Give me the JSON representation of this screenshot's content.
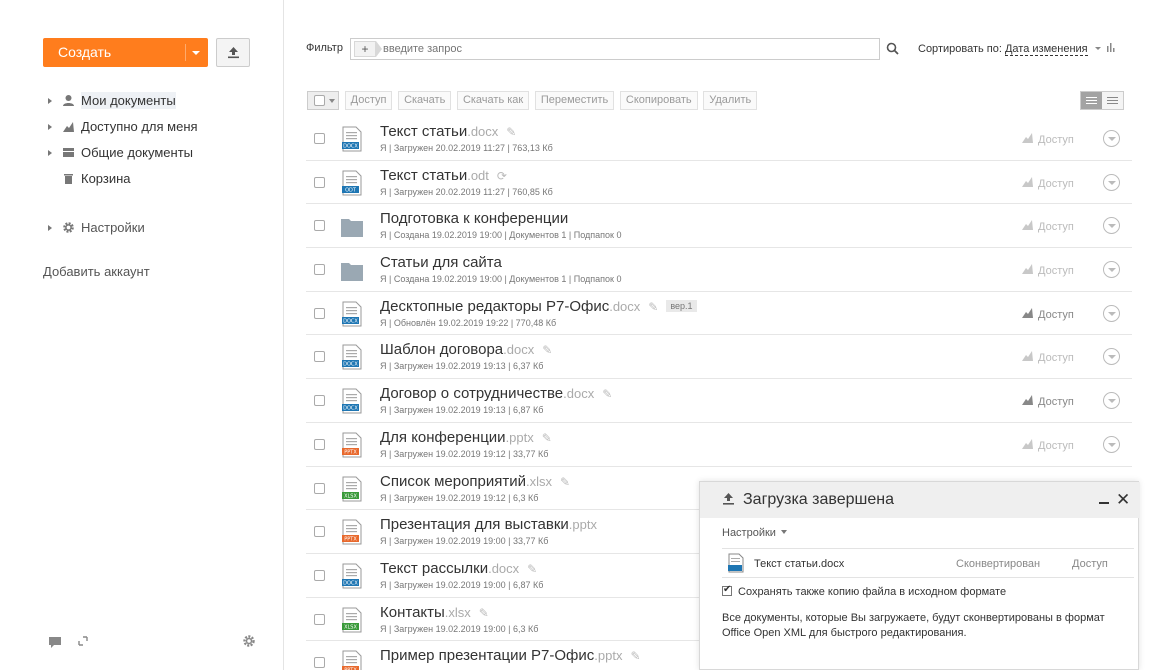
{
  "sidebar": {
    "create_label": "Создать",
    "nav": [
      {
        "label": "Мои документы",
        "icon": "user-icon",
        "active": true
      },
      {
        "label": "Доступно для меня",
        "icon": "share-icon",
        "active": false
      },
      {
        "label": "Общие документы",
        "icon": "folder-stack-icon",
        "active": false
      },
      {
        "label": "Корзина",
        "icon": "trash-icon",
        "active": false
      }
    ],
    "settings_label": "Настройки",
    "add_account": "Добавить аккаунт"
  },
  "filter": {
    "label": "Фильтр",
    "placeholder": "введите запрос",
    "sort_label": "Сортировать по:",
    "sort_value": "Дата изменения"
  },
  "toolbar": {
    "access": "Доступ",
    "download": "Скачать",
    "download_as": "Скачать как",
    "move": "Переместить",
    "copy": "Скопировать",
    "delete": "Удалить"
  },
  "files": [
    {
      "name": "Текст статьи",
      "ext": ".docx",
      "type": "DOCX",
      "meta": "Я | Загружен 20.02.2019 11:27 | 763,13 Кб",
      "mark": "✎",
      "access": "Доступ",
      "access_dark": false
    },
    {
      "name": "Текст статьи",
      "ext": ".odt",
      "type": "ODT",
      "meta": "Я | Загружен 20.02.2019 11:27 | 760,85 Кб",
      "mark": "⟳",
      "access": "Доступ",
      "access_dark": false
    },
    {
      "name": "Подготовка к конференции",
      "ext": "",
      "type": "folder",
      "meta": "Я | Создана 19.02.2019 19:00 | Документов 1 | Подпапок 0",
      "mark": "",
      "access": "Доступ",
      "access_dark": false
    },
    {
      "name": "Статьи для сайта",
      "ext": "",
      "type": "folder",
      "meta": "Я | Создана 19.02.2019 19:00 | Документов 1 | Подпапок 0",
      "mark": "",
      "access": "Доступ",
      "access_dark": false
    },
    {
      "name": "Десктопные редакторы Р7-Офис",
      "ext": ".docx",
      "type": "DOCX",
      "meta": "Я | Обновлён 19.02.2019 19:22 | 770,48 Кб",
      "mark": "✎",
      "version": "вер.1",
      "access": "Доступ",
      "access_dark": true
    },
    {
      "name": "Шаблон договора",
      "ext": ".docx",
      "type": "DOCX",
      "meta": "Я | Загружен 19.02.2019 19:13 | 6,37 Кб",
      "mark": "✎",
      "access": "Доступ",
      "access_dark": false
    },
    {
      "name": "Договор о сотрудничестве",
      "ext": ".docx",
      "type": "DOCX",
      "meta": "Я | Загружен 19.02.2019 19:13 | 6,87 Кб",
      "mark": "✎",
      "access": "Доступ",
      "access_dark": true
    },
    {
      "name": "Для конференции",
      "ext": ".pptx",
      "type": "PPTX",
      "meta": "Я | Загружен 19.02.2019 19:12 | 33,77 Кб",
      "mark": "✎",
      "access": "Доступ",
      "access_dark": false
    },
    {
      "name": "Список мероприятий",
      "ext": ".xlsx",
      "type": "XLSX",
      "meta": "Я | Загружен 19.02.2019 19:12 | 6,3 Кб",
      "mark": "✎",
      "access": "",
      "access_dark": false
    },
    {
      "name": "Презентация для выставки",
      "ext": ".pptx",
      "type": "PPTX",
      "meta": "Я | Загружен 19.02.2019 19:00 | 33,77 Кб",
      "mark": "",
      "access": "",
      "access_dark": false
    },
    {
      "name": "Текст рассылки",
      "ext": ".docx",
      "type": "DOCX",
      "meta": "Я | Загружен 19.02.2019 19:00 | 6,87 Кб",
      "mark": "✎",
      "access": "",
      "access_dark": false
    },
    {
      "name": "Контакты",
      "ext": ".xlsx",
      "type": "XLSX",
      "meta": "Я | Загружен 19.02.2019 19:00 | 6,3 Кб",
      "mark": "✎",
      "access": "",
      "access_dark": false
    },
    {
      "name": "Пример презентации Р7-Офис",
      "ext": ".pptx",
      "type": "PPTX",
      "meta": "",
      "mark": "✎",
      "access": "",
      "access_dark": false
    }
  ],
  "upload_panel": {
    "title": "Загрузка завершена",
    "settings": "Настройки",
    "file_name": "Текст статьи.docx",
    "file_status": "Сконвертирован",
    "file_access": "Доступ",
    "keep_copy": "Сохранять также копию файла в исходном формате",
    "note": "Все документы, которые Вы загружаете, будут сконвертированы в формат Office Open XML для быстрого редактирования."
  },
  "colors": {
    "accent": "#ff7d1d",
    "docx": "#1e76b3",
    "odt": "#1e76b3",
    "pptx": "#e8692d",
    "xlsx": "#3a9a3a",
    "folder": "#9aa8b3"
  }
}
